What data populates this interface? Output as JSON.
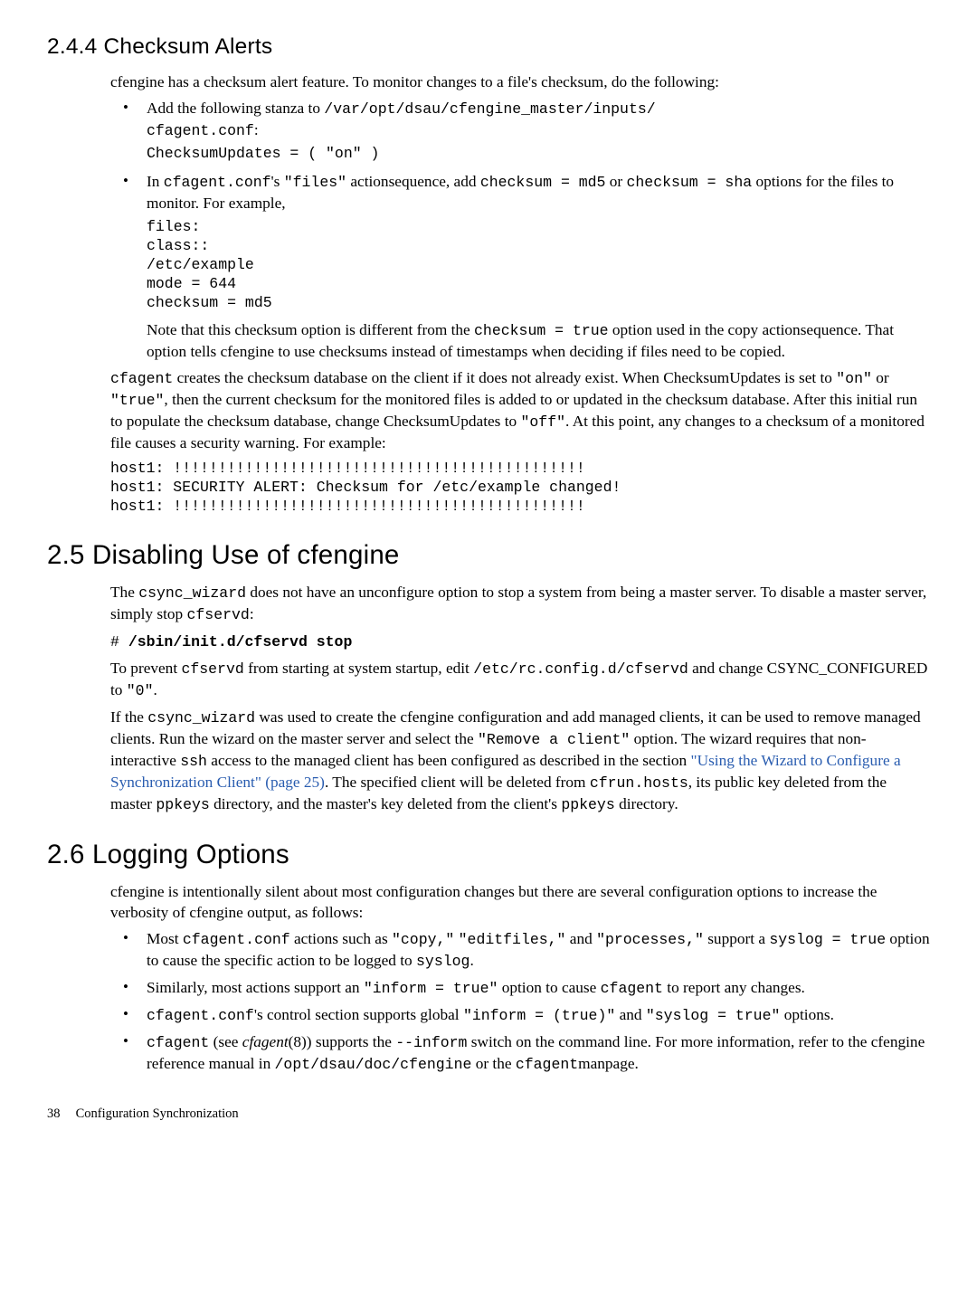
{
  "section244": {
    "title": "2.4.4 Checksum Alerts",
    "p1_a": "cfengine has a checksum alert feature. To monitor changes to a file's checksum, do the following:",
    "li1_a": "Add the following stanza to ",
    "li1_code1": "/var/opt/dsau/cfengine_master/inputs/",
    "li1_code2": "cfagent.conf",
    "li1_colon": ":",
    "li1_pre": "ChecksumUpdates = ( \"on\" )",
    "li2_a": "In ",
    "li2_code1": "cfagent.conf",
    "li2_b": "'s ",
    "li2_code2": "\"files\"",
    "li2_c": " actionsequence, add ",
    "li2_code3": "checksum = md5",
    "li2_d": " or ",
    "li2_code4": "checksum = sha",
    "li2_e": " options for the files to monitor. For example,",
    "li2_pre": "files:\nclass::\n/etc/example\nmode = 644\nchecksum = md5",
    "li2_note_a": "Note that this checksum option is different from the ",
    "li2_note_code": "checksum = true",
    "li2_note_b": " option used in the copy actionsequence. That option tells cfengine to use checksums instead of timestamps when deciding if files need to be copied.",
    "p2_code1": "cfagent",
    "p2_a": " creates the checksum database on the client if it does not already exist. When ChecksumUpdates is set to ",
    "p2_code2": "\"on\"",
    "p2_b": " or ",
    "p2_code3": "\"true\"",
    "p2_c": ", then the current checksum for the monitored files is added to or updated in the checksum database. After this initial run to populate the checksum database, change ChecksumUpdates to ",
    "p2_code4": "\"off\"",
    "p2_d": ". At this point, any changes to a checksum of a monitored file causes a security warning. For example:",
    "pre3": "host1: !!!!!!!!!!!!!!!!!!!!!!!!!!!!!!!!!!!!!!!!!!!!!!\nhost1: SECURITY ALERT: Checksum for /etc/example changed!\nhost1: !!!!!!!!!!!!!!!!!!!!!!!!!!!!!!!!!!!!!!!!!!!!!!"
  },
  "section25": {
    "title": "2.5 Disabling Use of cfengine",
    "p1_a": "The ",
    "p1_code1": "csync_wizard",
    "p1_b": " does not have an unconfigure option to stop a system from being a master server. To disable a master server, simply stop ",
    "p1_code2": "cfservd",
    "p1_c": ":",
    "cmd_hash": "# ",
    "cmd": "/sbin/init.d/cfservd stop",
    "p2_a": "To prevent ",
    "p2_code1": "cfservd",
    "p2_b": " from starting at system startup, edit ",
    "p2_code2": "/etc/rc.config.d/cfservd",
    "p2_c": " and change CSYNC_CONFIGURED to ",
    "p2_code3": "\"0\"",
    "p2_d": ".",
    "p3_a": "If the ",
    "p3_code1": "csync_wizard",
    "p3_b": " was used to create the cfengine configuration and add managed clients, it can be used to remove managed clients. Run the wizard on the master server and select the ",
    "p3_code2": "\"Remove a client\"",
    "p3_c": " option. The wizard requires that non-interactive ",
    "p3_code3": "ssh",
    "p3_d": " access to the managed client has been configured as described in the section ",
    "p3_link": "\"Using the Wizard to Configure a Synchronization Client\" (page 25)",
    "p3_e": ". The specified client will be deleted from ",
    "p3_code4": "cfrun.hosts",
    "p3_f": ", its public key deleted from the master ",
    "p3_code5": "ppkeys",
    "p3_g": " directory, and the master's key deleted from the client's ",
    "p3_code6": "ppkeys",
    "p3_h": " directory."
  },
  "section26": {
    "title": "2.6 Logging Options",
    "p1": "cfengine is intentionally silent about most configuration changes but there are several configuration options to increase the verbosity of cfengine output, as follows:",
    "li1_a": "Most ",
    "li1_code1": "cfagent.conf",
    "li1_b": " actions such as ",
    "li1_code2": "\"copy,\"",
    "li1_c": " ",
    "li1_code3": "\"editfiles,\"",
    "li1_d": " and ",
    "li1_code4": "\"processes,\"",
    "li1_e": " support a ",
    "li1_code5": "syslog = true",
    "li1_f": " option to cause the specific action to be logged to ",
    "li1_code6": "syslog",
    "li1_g": ".",
    "li2_a": "Similarly, most actions support an ",
    "li2_code1": "\"inform = true\"",
    "li2_b": " option to cause ",
    "li2_code2": "cfagent",
    "li2_c": " to report any changes.",
    "li3_code1": "cfagent.conf",
    "li3_a": "'s control section supports global ",
    "li3_code2": "\"inform = (true)\"",
    "li3_b": " and ",
    "li3_code3": "\"syslog = true\"",
    "li3_c": " options.",
    "li4_code1": "cfagent",
    "li4_a": " (see ",
    "li4_em": "cfagent",
    "li4_b": "(8)) supports the ",
    "li4_code2": "--inform",
    "li4_c": " switch on the command line. For more information, refer to the cfengine reference manual in ",
    "li4_code3": "/opt/dsau/doc/cfengine",
    "li4_d": " or the ",
    "li4_code4": "cfagent",
    "li4_e": "manpage."
  },
  "footer": {
    "page": "38",
    "chapter": "Configuration Synchronization"
  }
}
